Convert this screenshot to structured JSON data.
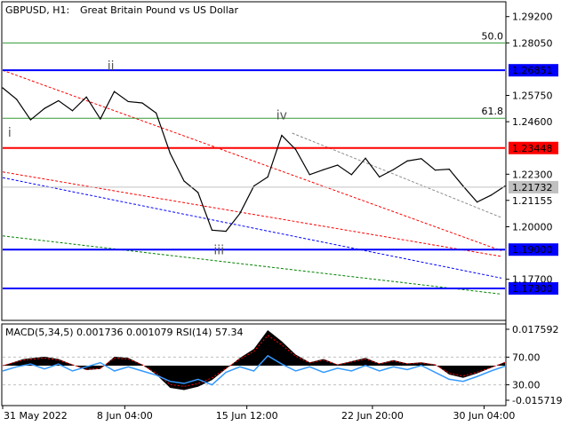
{
  "header": {
    "symbol": "GBPUSD, H1:",
    "description": "Great Britain Pound vs US Dollar"
  },
  "chart_data": {
    "type": "line",
    "title": "GBPUSD, H1:  Great Britain Pound vs US Dollar",
    "price_axis": {
      "ylim": [
        1.159,
        1.2985
      ],
      "ticks": [
        "1.29200",
        "1.28050",
        "1.25750",
        "1.24600",
        "1.22300",
        "1.21155",
        "1.20000",
        "1.17700"
      ]
    },
    "x_ticks": [
      "31 May 2022",
      "8 Jun 04:00",
      "15 Jun 12:00",
      "22 Jun 20:00",
      "30 Jun 04:00"
    ],
    "price_series": {
      "name": "GBPUSD",
      "color": "#000000",
      "x": [
        0,
        4,
        8,
        12,
        16,
        20,
        24,
        28,
        32,
        36,
        40,
        44,
        48,
        52,
        56,
        60,
        64,
        68,
        72,
        76,
        80,
        84,
        88,
        92,
        96,
        100,
        104,
        108,
        112,
        116,
        120,
        124,
        128,
        132,
        136,
        140,
        144
      ],
      "y": [
        1.2608,
        1.2558,
        1.2468,
        1.2518,
        1.2552,
        1.2508,
        1.2568,
        1.2472,
        1.2592,
        1.2548,
        1.2542,
        1.2498,
        1.2322,
        1.22,
        1.215,
        1.1985,
        1.198,
        1.2058,
        1.2178,
        1.2218,
        1.24,
        1.2338,
        1.2228,
        1.225,
        1.227,
        1.2228,
        1.23,
        1.2218,
        1.225,
        1.2288,
        1.2298,
        1.2248,
        1.2252,
        1.2178,
        1.2108,
        1.2138,
        1.2178
      ]
    },
    "levels": [
      {
        "value": 1.26851,
        "label": "1.26851",
        "color": "#0000ff"
      },
      {
        "value": 1.23448,
        "label": "1.23448",
        "color": "#ff0000"
      },
      {
        "value": 1.19,
        "label": "1.19000",
        "color": "#0000ff"
      },
      {
        "value": 1.173,
        "label": "1.17300",
        "color": "#0000ff"
      }
    ],
    "fib_levels": [
      {
        "value": 1.2805,
        "label": "50.0",
        "color": "#339933"
      },
      {
        "value": 1.2475,
        "label": "61.8",
        "color": "#339933"
      }
    ],
    "current_price": {
      "value": 1.21732,
      "label": "1.21732"
    },
    "wave_labels": [
      {
        "label": "i",
        "x": 2,
        "y": 1.2395
      },
      {
        "label": "ii",
        "x": 31,
        "y": 1.2685
      },
      {
        "label": "iii",
        "x": 62,
        "y": 1.188
      },
      {
        "label": "iv",
        "x": 80,
        "y": 1.247
      }
    ],
    "trend_lines": [
      {
        "color": "#ff0000",
        "from": [
          0,
          1.2685
        ],
        "to": [
          143,
          1.1895
        ]
      },
      {
        "color": "#ff0000",
        "from": [
          0,
          1.224
        ],
        "to": [
          143,
          1.187
        ]
      },
      {
        "color": "#0000ff",
        "from": [
          0,
          1.2215
        ],
        "to": [
          143,
          1.1775
        ]
      },
      {
        "color": "#008000",
        "from": [
          0,
          1.196
        ],
        "to": [
          143,
          1.1705
        ]
      },
      {
        "color": "#888888",
        "from": [
          83,
          1.241
        ],
        "to": [
          143,
          1.204
        ]
      }
    ],
    "indicator": {
      "label": "MACD(5,34,5) 0.001736 0.001079 RSI(14) 57.34",
      "ylim": [
        -0.018,
        0.0188
      ],
      "ticks": [
        "0.017592",
        "70.00",
        "30.00",
        "-0.015719"
      ],
      "macd_x": [
        0,
        6,
        12,
        16,
        20,
        24,
        28,
        32,
        36,
        40,
        44,
        48,
        52,
        56,
        60,
        64,
        68,
        72,
        76,
        80,
        84,
        88,
        92,
        96,
        100,
        104,
        108,
        112,
        116,
        120,
        124,
        128,
        132,
        136,
        140,
        144
      ],
      "macd_y": [
        0.0,
        0.003,
        0.004,
        0.003,
        0.0005,
        -0.002,
        -0.0015,
        0.004,
        0.0035,
        0.0005,
        -0.004,
        -0.01,
        -0.011,
        -0.0095,
        -0.0065,
        -0.0015,
        0.0035,
        0.0075,
        0.016,
        0.011,
        0.005,
        0.0015,
        0.003,
        0.0005,
        0.002,
        0.0035,
        0.001,
        0.0025,
        0.001,
        0.0015,
        0.0005,
        -0.004,
        -0.0055,
        -0.0035,
        -0.001,
        0.0017
      ],
      "rsi_x": [
        0,
        4,
        8,
        12,
        16,
        20,
        24,
        28,
        32,
        36,
        40,
        44,
        48,
        52,
        56,
        60,
        64,
        68,
        72,
        76,
        80,
        84,
        88,
        92,
        96,
        100,
        104,
        108,
        112,
        116,
        120,
        124,
        128,
        132,
        136,
        140,
        144
      ],
      "rsi_y": [
        50,
        56,
        60,
        53,
        60,
        50,
        56,
        62,
        50,
        56,
        50,
        44,
        35,
        32,
        38,
        30,
        48,
        56,
        50,
        72,
        60,
        50,
        56,
        48,
        54,
        50,
        58,
        50,
        56,
        52,
        58,
        48,
        38,
        35,
        42,
        50,
        57
      ]
    }
  }
}
